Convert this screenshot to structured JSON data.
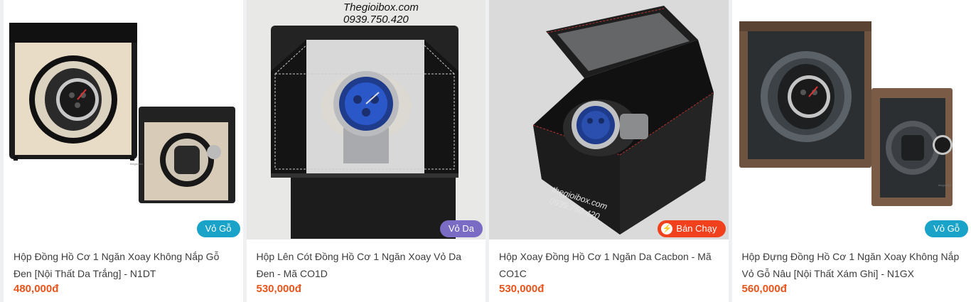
{
  "products": [
    {
      "title": "Hộp Đồng Hồ Cơ 1 Ngăn Xoay Không Nắp Gỗ Đen [Nội Thất Da Trắng] - N1DT",
      "price": "480,000đ",
      "badge": "Vỏ Gỗ",
      "badge_color": "#1aa3c9",
      "image_icon": "black-wood-watch-winder-image"
    },
    {
      "title": "Hộp Lên Cót Đồng Hồ Cơ 1 Ngăn Xoay Vỏ Da Đen - Mã CO1D",
      "price": "530,000đ",
      "badge": "Vỏ Da",
      "badge_color": "#7a6cc4",
      "image_icon": "black-leather-watch-winder-image",
      "watermark_site": "Thegioibox.com",
      "watermark_phone": "0939.750.420"
    },
    {
      "title": "Hộp Xoay Đồng Hồ Cơ 1 Ngăn Da Cacbon - Mã CO1C",
      "price": "530,000đ",
      "badge": "Bán Chạy",
      "badge_color": "#f0411c",
      "image_icon": "carbon-watch-winder-image",
      "watermark_site": "thegioibox.com",
      "watermark_phone": "0939.750.420"
    },
    {
      "title": "Hộp Đựng Đồng Hồ Cơ 1 Ngăn Xoay Không Nắp Vỏ Gỗ Nâu [Nội Thất Xám Ghi] - N1GX",
      "price": "560,000đ",
      "badge": "Vỏ Gỗ",
      "badge_color": "#1aa3c9",
      "image_icon": "brown-wood-watch-winder-image"
    }
  ]
}
